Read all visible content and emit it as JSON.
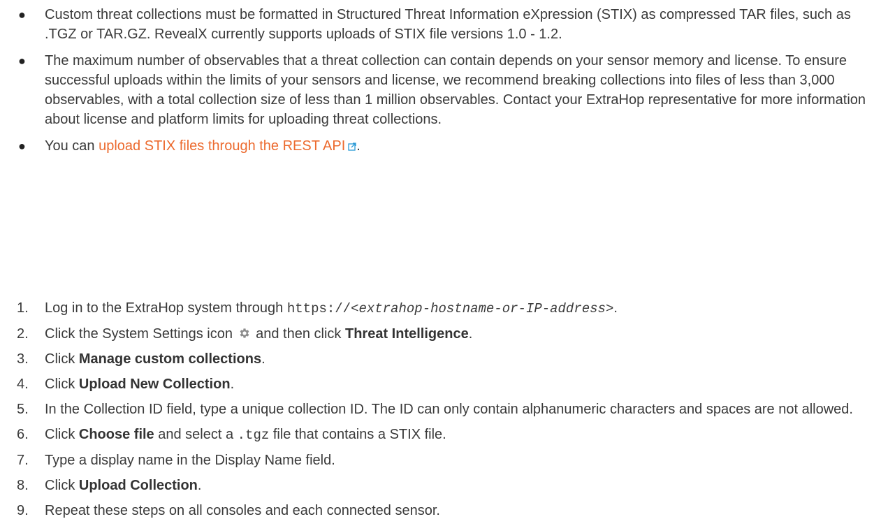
{
  "bullets": [
    {
      "text": "Custom threat collections must be formatted in Structured Threat Information eXpression (STIX) as compressed TAR files, such as .TGZ or TAR.GZ. RevealX currently supports uploads of STIX file versions 1.0 - 1.2."
    },
    {
      "text": "The maximum number of observables that a threat collection can contain depends on your sensor memory and license. To ensure successful uploads within the limits of your sensors and license, we recommend breaking collections into files of less than 3,000 observables, with a total collection size of less than 1 million observables. Contact your ExtraHop representative for more information about license and platform limits for uploading threat collections."
    },
    {
      "prefix": "You can ",
      "link": "upload STIX files through the REST API",
      "suffix": "."
    }
  ],
  "steps": [
    {
      "num": "1.",
      "prefix": "Log in to the ExtraHop system through ",
      "code_pre": "https://",
      "code_var": "<extrahop-hostname-or-IP-address>",
      "suffix": "."
    },
    {
      "num": "2.",
      "prefix": "Click the System Settings icon ",
      "middle": " and then click ",
      "bold": "Threat Intelligence",
      "suffix": ".",
      "icon": "gear-icon"
    },
    {
      "num": "3.",
      "prefix": "Click ",
      "bold": "Manage custom collections",
      "suffix": "."
    },
    {
      "num": "4.",
      "prefix": "Click ",
      "bold": "Upload New Collection",
      "suffix": "."
    },
    {
      "num": "5.",
      "text": "In the Collection ID field, type a unique collection ID. The ID can only contain alphanumeric characters and spaces are not allowed."
    },
    {
      "num": "6.",
      "prefix": "Click ",
      "bold": "Choose file",
      "middle": " and select a ",
      "code": ".tgz",
      "suffix": " file that contains a STIX file."
    },
    {
      "num": "7.",
      "text": "Type a display name in the Display Name field."
    },
    {
      "num": "8.",
      "prefix": "Click ",
      "bold": "Upload Collection",
      "suffix": "."
    },
    {
      "num": "9.",
      "text": "Repeat these steps on all consoles and each connected sensor."
    }
  ],
  "colors": {
    "link": "#ec6a2e",
    "text": "#3a3a3a",
    "external_link_icon": "#2a9ad6",
    "gear_icon": "#8c8c8c"
  }
}
